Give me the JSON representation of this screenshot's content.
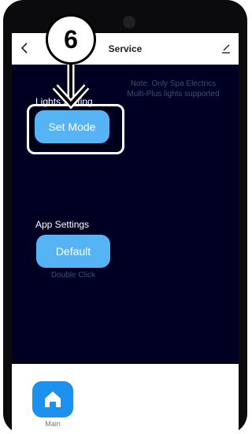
{
  "header": {
    "title": "Service",
    "back_icon": "chevron-left-icon",
    "edit_icon": "pencil-icon"
  },
  "note": {
    "line1": "Note: Only Spa Electrics",
    "line2": "Multi-Plus lights supported"
  },
  "lights": {
    "label": "Lights Setting",
    "button_label": "Set Mode"
  },
  "app_settings": {
    "label": "App Settings",
    "button_label": "Default",
    "sub_label": "Double Click"
  },
  "callout": {
    "step": "6"
  },
  "tabbar": {
    "items": [
      {
        "label": "Main",
        "icon": "home-icon",
        "active": true
      }
    ]
  },
  "colors": {
    "background": "#000022",
    "button": "#56b4f5",
    "tab_icon": "#1e90ee",
    "note_text": "#3d4f7a"
  }
}
